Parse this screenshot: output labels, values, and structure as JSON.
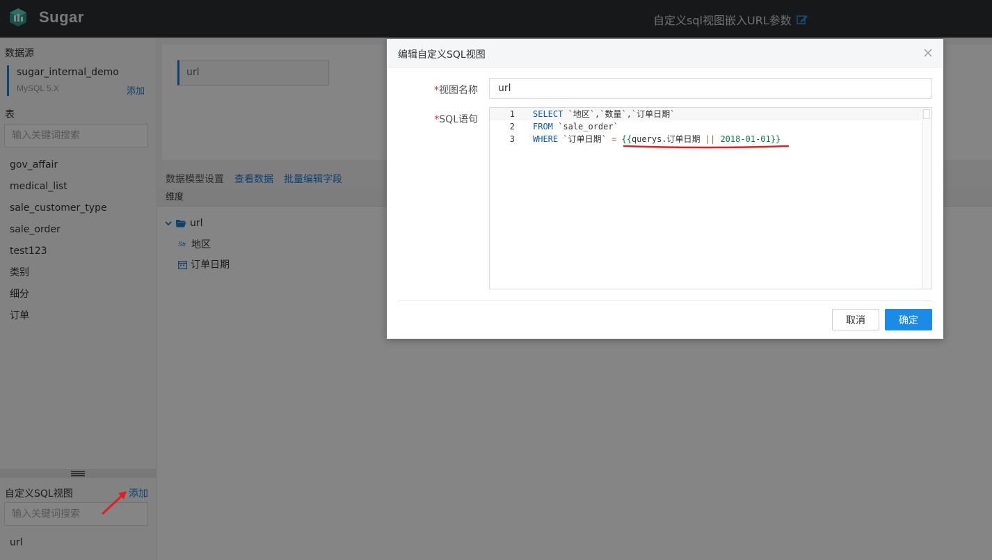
{
  "app": {
    "name": "Sugar",
    "page_title": "自定义sql视图嵌入URL参数"
  },
  "sidebar": {
    "datasource_label": "数据源",
    "datasource": {
      "name": "sugar_internal_demo",
      "type": "MySQL 5.X",
      "add_label": "添加"
    },
    "table_label": "表",
    "table_search_placeholder": "输入关键词搜索",
    "tables": [
      "gov_affair",
      "medical_list",
      "sale_customer_type",
      "sale_order",
      "test123",
      "类别",
      "细分",
      "订单"
    ],
    "sql_view_label": "自定义SQL视图",
    "sql_view_add_label": "添加",
    "sql_view_search_placeholder": "输入关键词搜索",
    "sql_views": [
      "url"
    ]
  },
  "main": {
    "view_name": "url",
    "tabs": [
      "数据模型设置",
      "查看数据",
      "批量编辑字段"
    ],
    "dimension_header": "维度",
    "tree": {
      "folder": "url",
      "fields": [
        {
          "type": "Str",
          "name": "地区"
        },
        {
          "type": "date",
          "name": "订单日期"
        }
      ]
    }
  },
  "modal": {
    "title": "编辑自定义SQL视图",
    "name_label": "视图名称",
    "name_value": "url",
    "sql_label": "SQL语句",
    "required_mark": "*",
    "code_lines": [
      {
        "num": "1",
        "kw": "SELECT",
        "rest": " `地区`,`数量`,`订单日期`"
      },
      {
        "num": "2",
        "kw": "FROM",
        "rest": " `sale_order`"
      },
      {
        "num": "3",
        "kw": "WHERE",
        "rest": " `订单日期` ",
        "op": "=",
        "open": " {{",
        "param": "querys.订单日期",
        "pipe": " || ",
        "date": "2018-01-01",
        "close": "}}"
      }
    ],
    "cancel_label": "取消",
    "ok_label": "确定"
  },
  "colors": {
    "accent": "#1a8ce8",
    "topbar": "#2b2f33",
    "annotation": "#e02020"
  }
}
